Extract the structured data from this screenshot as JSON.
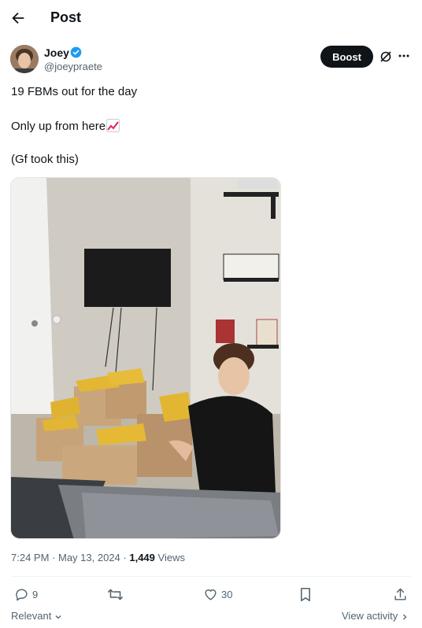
{
  "header": {
    "title": "Post"
  },
  "author": {
    "name": "Joey",
    "handle": "@joeypraete"
  },
  "boost_label": "Boost",
  "post": {
    "line1": "19 FBMs out for the day",
    "line2": "Only up from here",
    "line3": "(Gf took this)",
    "emoji": "chart-increasing"
  },
  "meta": {
    "time": "7:24 PM",
    "date": "May 13, 2024",
    "views_count": "1,449",
    "views_label": "Views"
  },
  "actions": {
    "replies": "9",
    "reposts": "",
    "likes": "30"
  },
  "footer": {
    "relevant": "Relevant",
    "view_activity": "View activity"
  },
  "colors": {
    "verified": "#1d9bf0",
    "boost_bg": "#0f1419",
    "muted": "#536471"
  },
  "icons": [
    "back-arrow-icon",
    "verified-badge-icon",
    "grok-icon",
    "more-icon",
    "reply-icon",
    "repost-icon",
    "like-icon",
    "bookmark-icon",
    "share-icon",
    "chevron-down-icon",
    "chevron-right-icon"
  ]
}
